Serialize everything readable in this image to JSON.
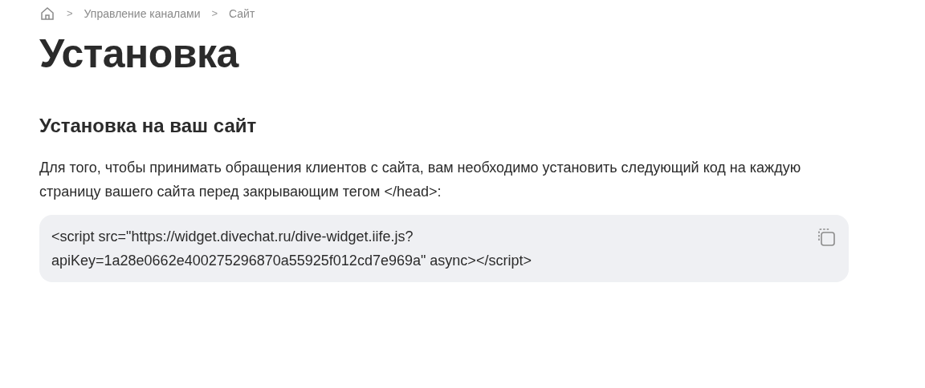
{
  "breadcrumb": [
    {
      "label": "Управление каналами"
    },
    {
      "label": "Сайт"
    }
  ],
  "breadcrumb_separator": ">",
  "title": "Установка",
  "section": {
    "heading": "Установка на ваш сайт",
    "text": "Для того, чтобы принимать обращения клиентов с сайта, вам необходимо установить следующий код на каждую страницу вашего сайта перед закрывающим тегом </head>:",
    "code_lines": [
      "<script src=\"https://widget.divechat.ru/dive-widget.iife.js?",
      "apiKey=1a28e0662e400275296870a55925f012cd7e969a\" async></script>"
    ]
  }
}
